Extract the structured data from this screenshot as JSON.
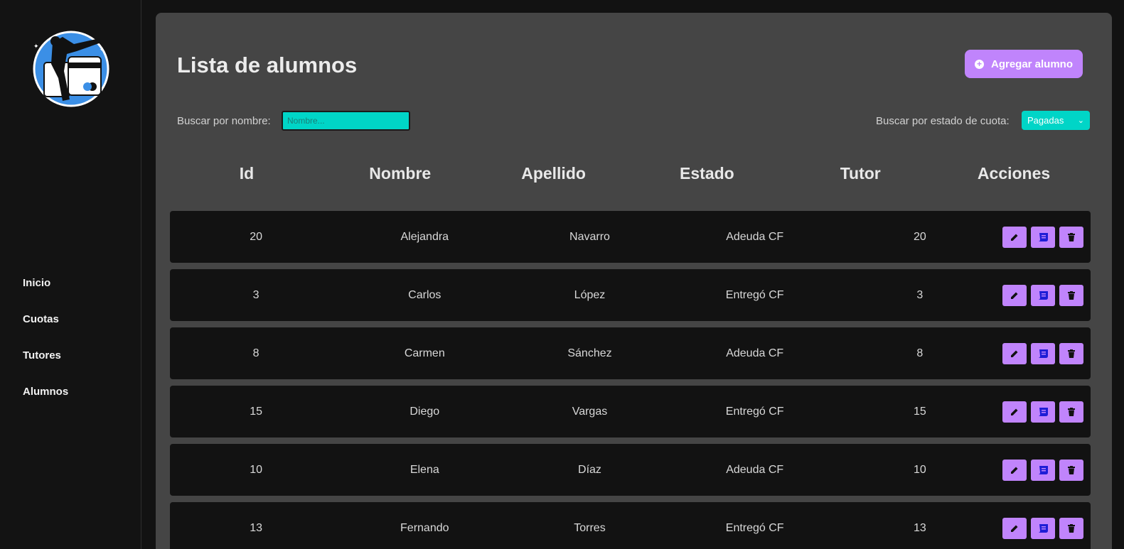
{
  "sidebar": {
    "nav": [
      {
        "label": "Inicio"
      },
      {
        "label": "Cuotas"
      },
      {
        "label": "Tutores"
      },
      {
        "label": "Alumnos"
      }
    ]
  },
  "main": {
    "title": "Lista de alumnos",
    "add_button": {
      "label": "Agregar alumno",
      "icon": "plus-circle-icon"
    },
    "search": {
      "label": "Buscar por nombre:",
      "placeholder": "Nombre..."
    },
    "filter": {
      "label": "Buscar por estado de cuota:",
      "selected": "Pagadas"
    },
    "table": {
      "columns": [
        "Id",
        "Nombre",
        "Apellido",
        "Estado",
        "Tutor",
        "Acciones"
      ],
      "rows": [
        {
          "id": "20",
          "nombre": "Alejandra",
          "apellido": "Navarro",
          "estado": "Adeuda CF",
          "tutor": "20"
        },
        {
          "id": "3",
          "nombre": "Carlos",
          "apellido": "López",
          "estado": "Entregó CF",
          "tutor": "3"
        },
        {
          "id": "8",
          "nombre": "Carmen",
          "apellido": "Sánchez",
          "estado": "Adeuda CF",
          "tutor": "8"
        },
        {
          "id": "15",
          "nombre": "Diego",
          "apellido": "Vargas",
          "estado": "Entregó CF",
          "tutor": "15"
        },
        {
          "id": "10",
          "nombre": "Elena",
          "apellido": "Díaz",
          "estado": "Adeuda CF",
          "tutor": "10"
        },
        {
          "id": "13",
          "nombre": "Fernando",
          "apellido": "Torres",
          "estado": "Entregó CF",
          "tutor": "13"
        }
      ],
      "row_actions": [
        "edit-icon",
        "receipt-icon",
        "trash-icon"
      ]
    }
  },
  "colors": {
    "accent": "#c084fc",
    "input": "#00d5c7",
    "panel": "#454545",
    "row": "#121212"
  }
}
